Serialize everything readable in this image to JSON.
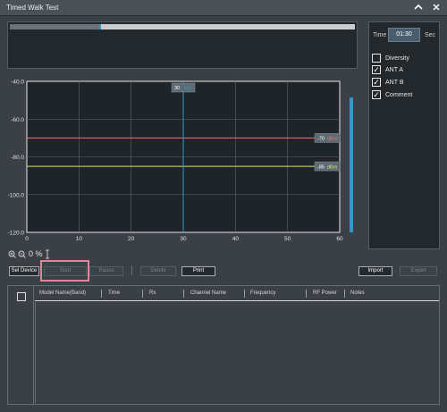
{
  "window": {
    "title": "Timed Walk Test"
  },
  "progress": {
    "fraction": 0.265
  },
  "right_panel": {
    "time_label": "Time",
    "time_value": "01:30",
    "time_unit": "Sec",
    "options": [
      {
        "label": "Diversity",
        "checked": false
      },
      {
        "label": "ANT A",
        "checked": true
      },
      {
        "label": "ANT B",
        "checked": true
      },
      {
        "label": "Comment",
        "checked": true
      }
    ]
  },
  "chart_data": {
    "type": "line",
    "ylim": [
      -120,
      -40
    ],
    "xlim": [
      0,
      60
    ],
    "y_ticks": [
      "-40.0",
      "-60.0",
      "-80.0",
      "-100.0",
      "-120.0"
    ],
    "x_ticks": [
      "0",
      "10",
      "20",
      "30",
      "40",
      "50",
      "60"
    ],
    "cursor": {
      "x": 30,
      "label": "30",
      "unit": "sec"
    },
    "series": [
      {
        "value": -70,
        "label": "-70",
        "unit": "dBm",
        "color": "#e8776a"
      },
      {
        "value": -85,
        "label": "-85",
        "unit": "dBm",
        "color": "#e6e06a"
      }
    ],
    "grid": true
  },
  "zoom": {
    "percent": "0 %"
  },
  "toolbar": {
    "sel_device": "Sel Device",
    "start": "Start",
    "pause": "Pause",
    "delete": "Delete",
    "print": "Print",
    "import": "Import",
    "export": "Export"
  },
  "table": {
    "columns": [
      "Model Name(Band)",
      "Time",
      "Rx",
      "Channel Name",
      "Frequency",
      "RF Power",
      "Notes"
    ]
  },
  "colors": {
    "accent": "#2e9ad0",
    "highlight": "#e0869a"
  }
}
